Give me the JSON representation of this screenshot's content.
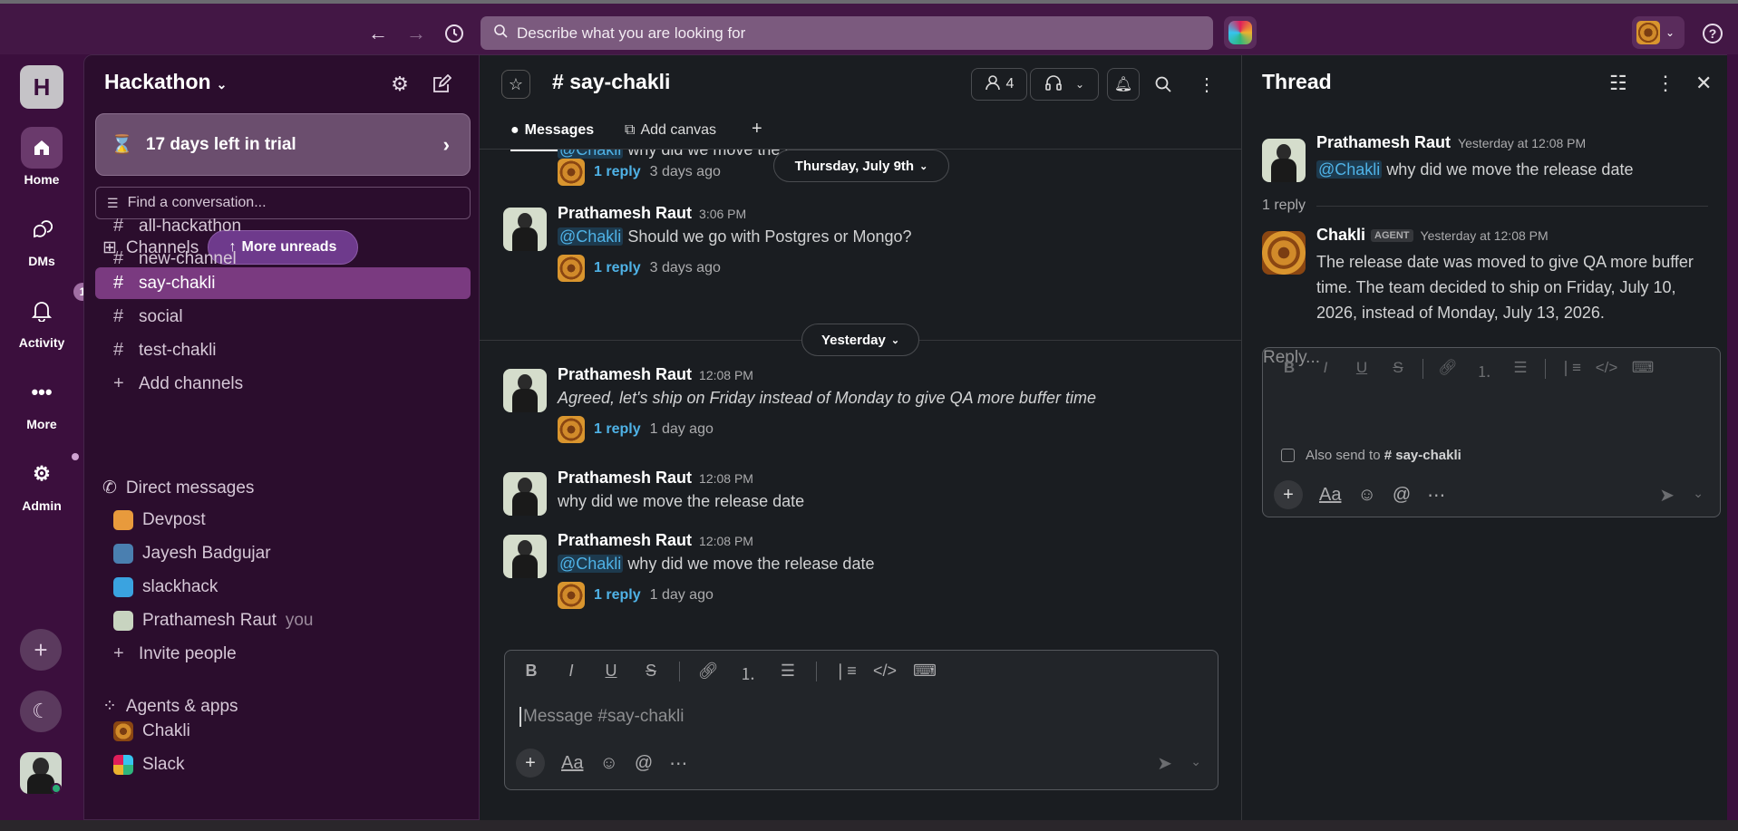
{
  "topbar": {
    "search_placeholder": "Describe what you are looking for",
    "help_label": "?"
  },
  "rail": {
    "workspace_initial": "H",
    "items": [
      {
        "label": "Home"
      },
      {
        "label": "DMs"
      },
      {
        "label": "Activity",
        "badge": "1"
      },
      {
        "label": "More"
      },
      {
        "label": "Admin"
      }
    ]
  },
  "sidebar": {
    "workspace_name": "Hackathon",
    "trial_text": "17 days left in trial",
    "find_placeholder": "Find a conversation...",
    "channels_header": "Channels",
    "more_unreads": "More unreads",
    "channels": [
      "all-hackathon",
      "new-channel",
      "say-chakli",
      "social",
      "test-chakli"
    ],
    "add_channels": "Add channels",
    "dm_header": "Direct messages",
    "dms": [
      "Devpost",
      "Jayesh Badgujar",
      "slackhack",
      "Prathamesh Raut"
    ],
    "you_label": "you",
    "invite_people": "Invite people",
    "apps_header": "Agents & apps",
    "apps": [
      "Chakli",
      "Slack"
    ]
  },
  "channel": {
    "title": "say-chakli",
    "member_count": "4",
    "tabs": {
      "messages": "Messages",
      "add_canvas": "Add canvas"
    },
    "date_pills": {
      "first": "Thursday, July 9th",
      "second": "Yesterday"
    },
    "messages": [
      {
        "mention": "@Chakli",
        "text": "why did we move the release date",
        "reply_count": "1 reply",
        "reply_ago": "3 days ago"
      },
      {
        "author": "Prathamesh Raut",
        "time": "3:06 PM",
        "mention": "@Chakli",
        "text": "Should we go with Postgres or Mongo?",
        "reply_count": "1 reply",
        "reply_ago": "3 days ago"
      },
      {
        "author": "Prathamesh Raut",
        "time": "12:08 PM",
        "text": "Agreed, let's ship on Friday instead of Monday to give QA more buffer time",
        "reply_count": "1 reply",
        "reply_ago": "1 day ago"
      },
      {
        "author": "Prathamesh Raut",
        "time": "12:08 PM",
        "text": "why did we move the release date"
      },
      {
        "author": "Prathamesh Raut",
        "time": "12:08 PM",
        "mention": "@Chakli",
        "text": "why did we move the release date",
        "reply_count": "1 reply",
        "reply_ago": "1 day ago"
      }
    ],
    "composer_placeholder": "Message #say-chakli"
  },
  "thread": {
    "title": "Thread",
    "parent": {
      "author": "Prathamesh Raut",
      "time": "Yesterday at 12:08 PM",
      "mention": "@Chakli",
      "text": "why did we move the release date"
    },
    "reply_count": "1 reply",
    "reply": {
      "author": "Chakli",
      "tag": "AGENT",
      "time": "Yesterday at 12:08 PM",
      "text": "The release date was moved to give QA more buffer time. The team decided to ship on Friday, July 10, 2026, instead of Monday, July 13, 2026."
    },
    "reply_placeholder": "Reply...",
    "also_send_prefix": "Also send to",
    "also_send_channel": "say-chakli"
  },
  "colors": {
    "aubergine": "#3b0f3d",
    "active_channel": "#7a3a80",
    "mention": "#4fb2e6"
  }
}
